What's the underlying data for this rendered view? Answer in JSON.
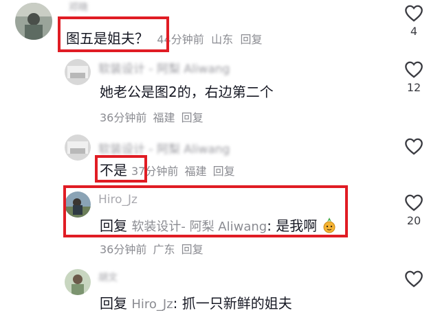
{
  "comments": [
    {
      "username": "邓晓",
      "text": "图五是姐夫？",
      "meta": {
        "time": "44分钟前",
        "location": "山东",
        "reply": "回复"
      },
      "likes": "4"
    },
    {
      "username": "软装设计 - 阿梨 Aliwang",
      "text": "她老公是图2的，右边第二个",
      "meta": {
        "time": "36分钟前",
        "location": "福建",
        "reply": "回复"
      },
      "likes": "12"
    },
    {
      "username": "软装设计 - 阿梨 Aliwang",
      "text": "不是",
      "meta": {
        "time": "37分钟前",
        "location": "福建",
        "reply": "回复"
      },
      "likes": ""
    },
    {
      "username": "Hiro_Jz",
      "reply_prefix": "回复",
      "mention": "软装设计- 阿梨 Aliwang",
      "text": ": 是我啊",
      "emoji": "pineapple-emoji",
      "meta": {
        "time": "36分钟前",
        "location": "广东",
        "reply": "回复"
      },
      "likes": "20"
    },
    {
      "username": "胡文",
      "reply_prefix": "回复",
      "mention": "Hiro_Jz",
      "text": ": 抓一只新鲜的姐夫",
      "likes": ""
    }
  ],
  "colors": {
    "highlight": "#e01c24",
    "meta": "#8a8b91",
    "text": "#161823"
  }
}
